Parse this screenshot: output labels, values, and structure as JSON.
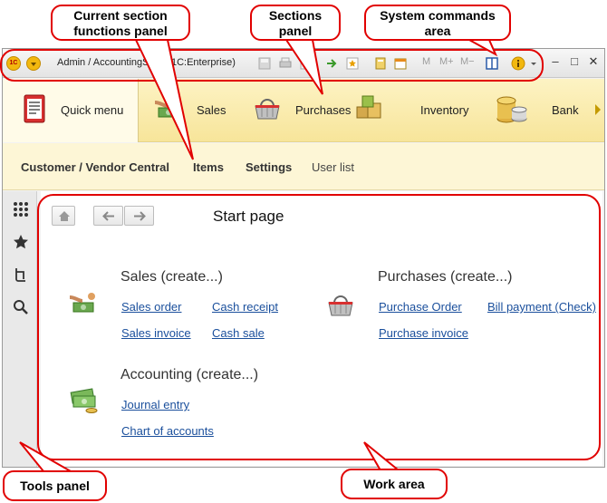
{
  "window": {
    "title": "Admin / AccountingSuite (1C:Enterprise)",
    "logo_text": "1C",
    "toolbar_buttons": [
      "M",
      "M+",
      "M−"
    ]
  },
  "sections": [
    {
      "label": "Quick menu",
      "icon": "quick-menu-icon"
    },
    {
      "label": "Sales",
      "icon": "sales-icon"
    },
    {
      "label": "Purchases",
      "icon": "basket-icon"
    },
    {
      "label": "Inventory",
      "icon": "boxes-icon"
    },
    {
      "label": "Bank",
      "icon": "coins-icon"
    }
  ],
  "functions": [
    "Customer / Vendor Central",
    "Items",
    "Settings",
    "User list"
  ],
  "tools": [
    "apps-grid-icon",
    "star-icon",
    "history-icon",
    "search-icon"
  ],
  "work": {
    "page_title": "Start page",
    "sales_group": {
      "title": "Sales (create...)",
      "links": [
        "Sales order",
        "Cash receipt",
        "Sales invoice",
        "Cash sale"
      ]
    },
    "purchases_group": {
      "title": "Purchases (create...)",
      "links": [
        "Purchase Order",
        "Bill payment (Check)",
        "Purchase invoice"
      ]
    },
    "accounting_group": {
      "title": "Accounting (create...)",
      "links": [
        "Journal entry",
        "Chart of accounts"
      ]
    }
  },
  "callouts": {
    "functions_panel": "Current section functions panel",
    "sections_panel": "Sections panel",
    "system_commands": "System commands area",
    "tools_panel": "Tools panel",
    "work_area": "Work area"
  },
  "colors": {
    "callout": "#e10000",
    "sections_bg": "#f7e59a",
    "link": "#1a4f9c"
  }
}
